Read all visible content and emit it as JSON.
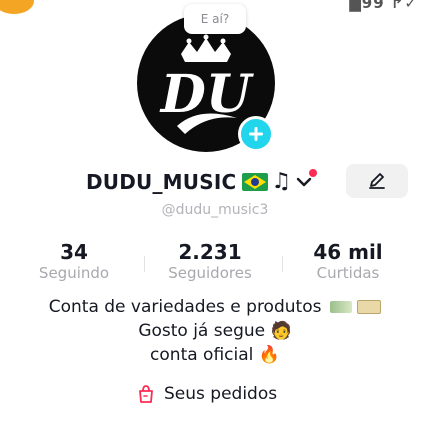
{
  "top_bar": {
    "right_text": "█99 •✔"
  },
  "bubble": {
    "text": "E aí?"
  },
  "profile": {
    "avatar_text": "DU",
    "username": "DUDU_MUSIC",
    "handle": "@dudu_music3"
  },
  "stats": [
    {
      "value": "34",
      "label": "Seguindo"
    },
    {
      "value": "2.231",
      "label": "Seguidores"
    },
    {
      "value": "46 mil",
      "label": "Curtidas"
    }
  ],
  "bio": {
    "line1": "Conta de variedades e produtos",
    "line2": "Gosto já segue",
    "line3": "conta oficial"
  },
  "orders": {
    "label": "Seus pedidos"
  },
  "colors": {
    "accent": "#20d5ec",
    "notification": "#fe2c55",
    "orders_icon": "#fe2c55"
  },
  "icons": [
    "edit-pencil-icon",
    "plus-icon",
    "verified-chevron-icon",
    "shopping-bag-icon"
  ]
}
